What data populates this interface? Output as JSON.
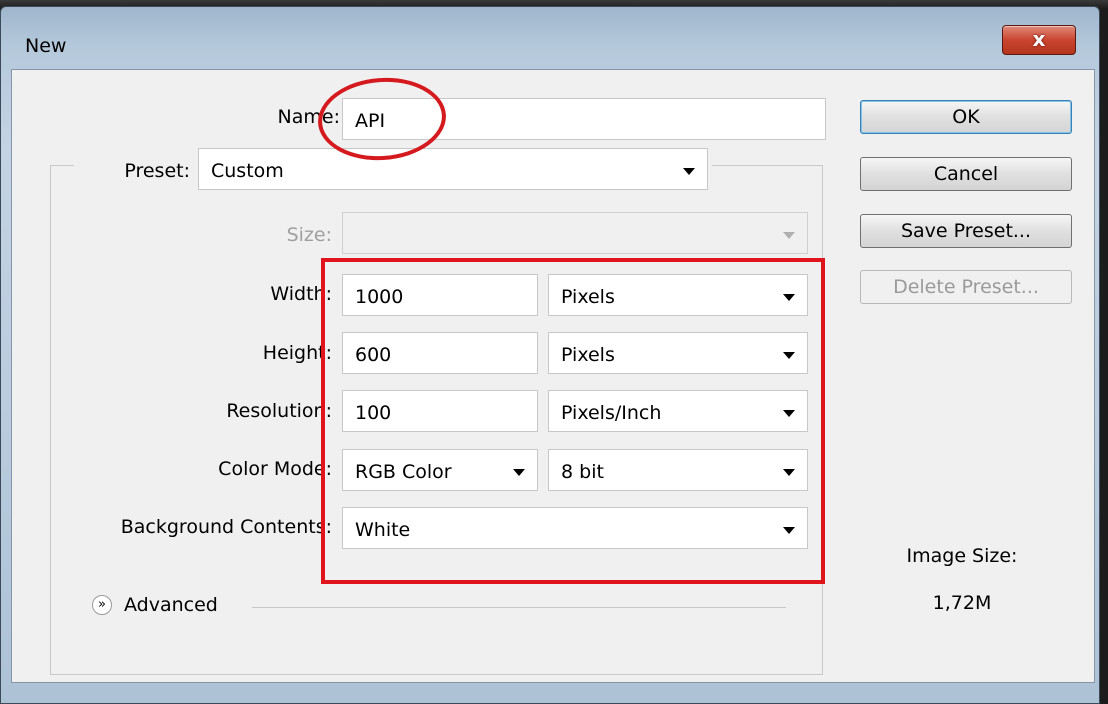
{
  "window": {
    "title": "New",
    "close_glyph": "x"
  },
  "form": {
    "name_label": "Name:",
    "name_value": "API",
    "preset_label": "Preset:",
    "preset_value": "Custom",
    "size_label": "Size:",
    "size_value": "",
    "width_label": "Width:",
    "width_value": "1000",
    "width_unit": "Pixels",
    "height_label": "Height:",
    "height_value": "600",
    "height_unit": "Pixels",
    "resolution_label": "Resolution:",
    "resolution_value": "100",
    "resolution_unit": "Pixels/Inch",
    "color_mode_label": "Color Mode:",
    "color_mode_value": "RGB Color",
    "bit_depth_value": "8 bit",
    "background_label": "Background Contents:",
    "background_value": "White",
    "advanced_label": "Advanced",
    "advanced_icon": "double-chevron-down-icon"
  },
  "buttons": {
    "ok": "OK",
    "cancel": "Cancel",
    "save_preset": "Save Preset...",
    "delete_preset": "Delete Preset..."
  },
  "info": {
    "image_size_label": "Image Size:",
    "image_size_value": "1,72M"
  },
  "annotations": {
    "highlight_color": "#e0141c"
  }
}
